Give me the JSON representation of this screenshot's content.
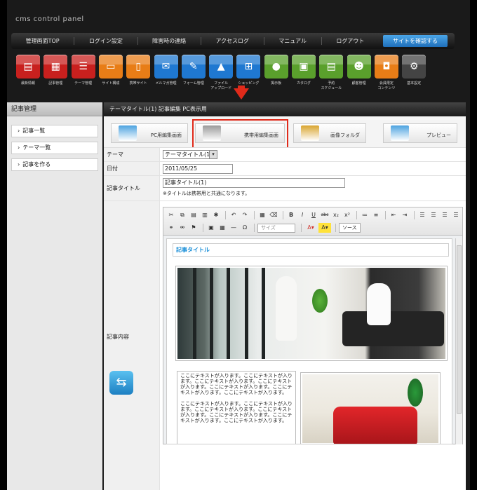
{
  "app": {
    "title": "cms control panel"
  },
  "nav": {
    "items": [
      "管理画面TOP",
      "ログイン設定",
      "障害時の連絡",
      "アクセスログ",
      "マニュアル",
      "ログアウト"
    ],
    "confirm": "サイトを確認する"
  },
  "tools": [
    {
      "label": "最新情報",
      "icon": "news-icon",
      "color": "#c8201e",
      "glyph": "▤"
    },
    {
      "label": "記事管理",
      "icon": "article-icon",
      "color": "#c8201e",
      "glyph": "▦"
    },
    {
      "label": "テーマ管理",
      "icon": "theme-icon",
      "color": "#c8201e",
      "glyph": "☰"
    },
    {
      "label": "サイト構成",
      "icon": "site-structure-icon",
      "color": "#e87d17",
      "glyph": "▭"
    },
    {
      "label": "携帯サイト",
      "icon": "mobile-site-icon",
      "color": "#e87d17",
      "glyph": "▯"
    },
    {
      "label": "メルマガ管理",
      "icon": "mail-icon",
      "color": "#1f78d1",
      "glyph": "✉"
    },
    {
      "label": "フォーム管理",
      "icon": "form-icon",
      "color": "#1f78d1",
      "glyph": "✎"
    },
    {
      "label": "ファイル\nアップロード",
      "icon": "file-upload-icon",
      "color": "#1f78d1",
      "glyph": "▲"
    },
    {
      "label": "ショッピング",
      "icon": "shopping-icon",
      "color": "#1f78d1",
      "glyph": "⊞"
    },
    {
      "label": "掲示板",
      "icon": "bbs-icon",
      "color": "#5aa02c",
      "glyph": "●"
    },
    {
      "label": "カタログ",
      "icon": "catalog-icon",
      "color": "#5aa02c",
      "glyph": "▣"
    },
    {
      "label": "予約\nスケジュール",
      "icon": "schedule-icon",
      "color": "#5aa02c",
      "glyph": "▤"
    },
    {
      "label": "顧客管理",
      "icon": "customer-icon",
      "color": "#5aa02c",
      "glyph": "☻"
    },
    {
      "label": "会員限定\nコンテンツ",
      "icon": "member-lock-icon",
      "color": "#e87d17",
      "glyph": "◘"
    },
    {
      "label": "基本設定",
      "icon": "gear-icon",
      "color": "#444444",
      "glyph": "⚙"
    }
  ],
  "sidebar": {
    "title": "記事管理",
    "items": [
      "記事一覧",
      "テーマ一覧",
      "記事を作る"
    ]
  },
  "main": {
    "header": "テーマタイトル(1) 記事編集 PC表示用",
    "tabs": [
      {
        "label": "PC用編集画面",
        "color": "#4da3e0"
      },
      {
        "label": "携帯用編集画面",
        "color": "#9a9a9a"
      },
      {
        "label": "画像フォルダ",
        "color": "#d9a530"
      },
      {
        "label": "プレビュー",
        "color": "#4da3e0"
      }
    ]
  },
  "form": {
    "theme": {
      "label": "テーマ",
      "value": "テーマタイトル(1)"
    },
    "date": {
      "label": "日付",
      "value": "2011/05/25"
    },
    "title": {
      "label": "記事タイトル",
      "value": "記事タイトル(1)",
      "note": "※タイトルは携帯用と共通になります。"
    },
    "content": {
      "label": "記事内容"
    }
  },
  "editor": {
    "size_combo": "サイズ",
    "source": "ソース",
    "heading": "記事タイトル",
    "paragraph": "ここにテキストが入ります。ここにテキストが入ります。ここにテキストが入ります。ここにテキストが入ります。ここにテキストが入ります。ここにテキストが入ります。ここにテキストが入ります。"
  }
}
